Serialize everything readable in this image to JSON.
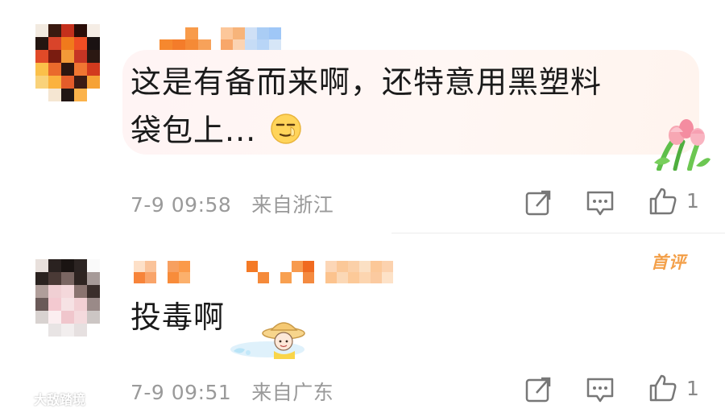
{
  "comments": [
    {
      "text_line1": "这是有备而来啊，还特意用黑塑料",
      "text_line2": "袋包上...",
      "time": "7-9 09:58",
      "location": "来自浙江",
      "like_count": "1",
      "emoji_icon": "smirk-emoji-icon",
      "sticker_icon": "tulip-sticker-icon"
    },
    {
      "text_line1": "投毒啊",
      "time": "7-9 09:51",
      "location": "来自广东",
      "like_count": "1",
      "badge": "首评",
      "sticker_icon": "cartoon-girl-sticker-icon"
    }
  ],
  "watermark": {
    "text": "大敌踏境",
    "icon": "watermark-logo-icon"
  },
  "icons": {
    "share": "share-icon",
    "comment": "comment-icon",
    "like": "thumb-up-icon"
  },
  "colors": {
    "text": "#1a1a1a",
    "meta": "#9a9a9a",
    "badge": "#f3a04a",
    "bubble": "#fff4f4"
  }
}
